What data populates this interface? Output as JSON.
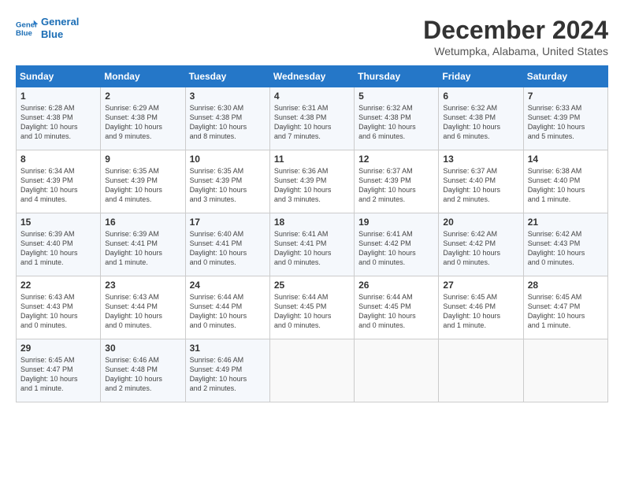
{
  "logo": {
    "line1": "General",
    "line2": "Blue"
  },
  "title": "December 2024",
  "location": "Wetumpka, Alabama, United States",
  "days_of_week": [
    "Sunday",
    "Monday",
    "Tuesday",
    "Wednesday",
    "Thursday",
    "Friday",
    "Saturday"
  ],
  "weeks": [
    [
      {
        "day": "1",
        "info": "Sunrise: 6:28 AM\nSunset: 4:38 PM\nDaylight: 10 hours\nand 10 minutes."
      },
      {
        "day": "2",
        "info": "Sunrise: 6:29 AM\nSunset: 4:38 PM\nDaylight: 10 hours\nand 9 minutes."
      },
      {
        "day": "3",
        "info": "Sunrise: 6:30 AM\nSunset: 4:38 PM\nDaylight: 10 hours\nand 8 minutes."
      },
      {
        "day": "4",
        "info": "Sunrise: 6:31 AM\nSunset: 4:38 PM\nDaylight: 10 hours\nand 7 minutes."
      },
      {
        "day": "5",
        "info": "Sunrise: 6:32 AM\nSunset: 4:38 PM\nDaylight: 10 hours\nand 6 minutes."
      },
      {
        "day": "6",
        "info": "Sunrise: 6:32 AM\nSunset: 4:38 PM\nDaylight: 10 hours\nand 6 minutes."
      },
      {
        "day": "7",
        "info": "Sunrise: 6:33 AM\nSunset: 4:39 PM\nDaylight: 10 hours\nand 5 minutes."
      }
    ],
    [
      {
        "day": "8",
        "info": "Sunrise: 6:34 AM\nSunset: 4:39 PM\nDaylight: 10 hours\nand 4 minutes."
      },
      {
        "day": "9",
        "info": "Sunrise: 6:35 AM\nSunset: 4:39 PM\nDaylight: 10 hours\nand 4 minutes."
      },
      {
        "day": "10",
        "info": "Sunrise: 6:35 AM\nSunset: 4:39 PM\nDaylight: 10 hours\nand 3 minutes."
      },
      {
        "day": "11",
        "info": "Sunrise: 6:36 AM\nSunset: 4:39 PM\nDaylight: 10 hours\nand 3 minutes."
      },
      {
        "day": "12",
        "info": "Sunrise: 6:37 AM\nSunset: 4:39 PM\nDaylight: 10 hours\nand 2 minutes."
      },
      {
        "day": "13",
        "info": "Sunrise: 6:37 AM\nSunset: 4:40 PM\nDaylight: 10 hours\nand 2 minutes."
      },
      {
        "day": "14",
        "info": "Sunrise: 6:38 AM\nSunset: 4:40 PM\nDaylight: 10 hours\nand 1 minute."
      }
    ],
    [
      {
        "day": "15",
        "info": "Sunrise: 6:39 AM\nSunset: 4:40 PM\nDaylight: 10 hours\nand 1 minute."
      },
      {
        "day": "16",
        "info": "Sunrise: 6:39 AM\nSunset: 4:41 PM\nDaylight: 10 hours\nand 1 minute."
      },
      {
        "day": "17",
        "info": "Sunrise: 6:40 AM\nSunset: 4:41 PM\nDaylight: 10 hours\nand 0 minutes."
      },
      {
        "day": "18",
        "info": "Sunrise: 6:41 AM\nSunset: 4:41 PM\nDaylight: 10 hours\nand 0 minutes."
      },
      {
        "day": "19",
        "info": "Sunrise: 6:41 AM\nSunset: 4:42 PM\nDaylight: 10 hours\nand 0 minutes."
      },
      {
        "day": "20",
        "info": "Sunrise: 6:42 AM\nSunset: 4:42 PM\nDaylight: 10 hours\nand 0 minutes."
      },
      {
        "day": "21",
        "info": "Sunrise: 6:42 AM\nSunset: 4:43 PM\nDaylight: 10 hours\nand 0 minutes."
      }
    ],
    [
      {
        "day": "22",
        "info": "Sunrise: 6:43 AM\nSunset: 4:43 PM\nDaylight: 10 hours\nand 0 minutes."
      },
      {
        "day": "23",
        "info": "Sunrise: 6:43 AM\nSunset: 4:44 PM\nDaylight: 10 hours\nand 0 minutes."
      },
      {
        "day": "24",
        "info": "Sunrise: 6:44 AM\nSunset: 4:44 PM\nDaylight: 10 hours\nand 0 minutes."
      },
      {
        "day": "25",
        "info": "Sunrise: 6:44 AM\nSunset: 4:45 PM\nDaylight: 10 hours\nand 0 minutes."
      },
      {
        "day": "26",
        "info": "Sunrise: 6:44 AM\nSunset: 4:45 PM\nDaylight: 10 hours\nand 0 minutes."
      },
      {
        "day": "27",
        "info": "Sunrise: 6:45 AM\nSunset: 4:46 PM\nDaylight: 10 hours\nand 1 minute."
      },
      {
        "day": "28",
        "info": "Sunrise: 6:45 AM\nSunset: 4:47 PM\nDaylight: 10 hours\nand 1 minute."
      }
    ],
    [
      {
        "day": "29",
        "info": "Sunrise: 6:45 AM\nSunset: 4:47 PM\nDaylight: 10 hours\nand 1 minute."
      },
      {
        "day": "30",
        "info": "Sunrise: 6:46 AM\nSunset: 4:48 PM\nDaylight: 10 hours\nand 2 minutes."
      },
      {
        "day": "31",
        "info": "Sunrise: 6:46 AM\nSunset: 4:49 PM\nDaylight: 10 hours\nand 2 minutes."
      },
      {
        "day": "",
        "info": ""
      },
      {
        "day": "",
        "info": ""
      },
      {
        "day": "",
        "info": ""
      },
      {
        "day": "",
        "info": ""
      }
    ]
  ]
}
